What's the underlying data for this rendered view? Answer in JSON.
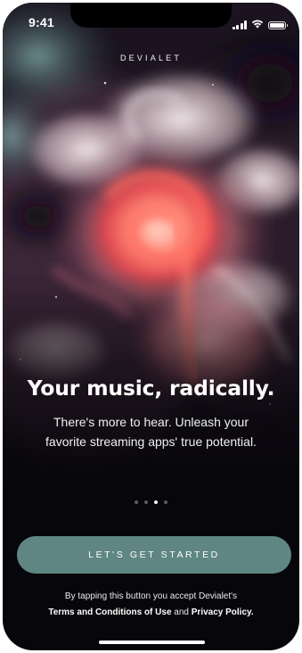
{
  "status_bar": {
    "time": "9:41",
    "battery_level": 0.9
  },
  "brand": {
    "name": "DEVIALET"
  },
  "hero": {
    "headline": "Your music, radically.",
    "subtext": "There's more to hear. Unleash your favorite streaming apps' true potential."
  },
  "pager": {
    "total": 4,
    "active_index": 2
  },
  "cta": {
    "label": "LET'S GET STARTED"
  },
  "legal": {
    "prefix": "By tapping this button you accept Devialet's",
    "terms_link": "Terms and Conditions of Use",
    "joiner": " and ",
    "privacy_link": "Privacy Policy",
    "suffix": "."
  },
  "colors": {
    "cta_background": "#5f8682",
    "background": "#07060a"
  },
  "icons": [
    "cellular-signal-icon",
    "wifi-icon",
    "battery-icon"
  ]
}
